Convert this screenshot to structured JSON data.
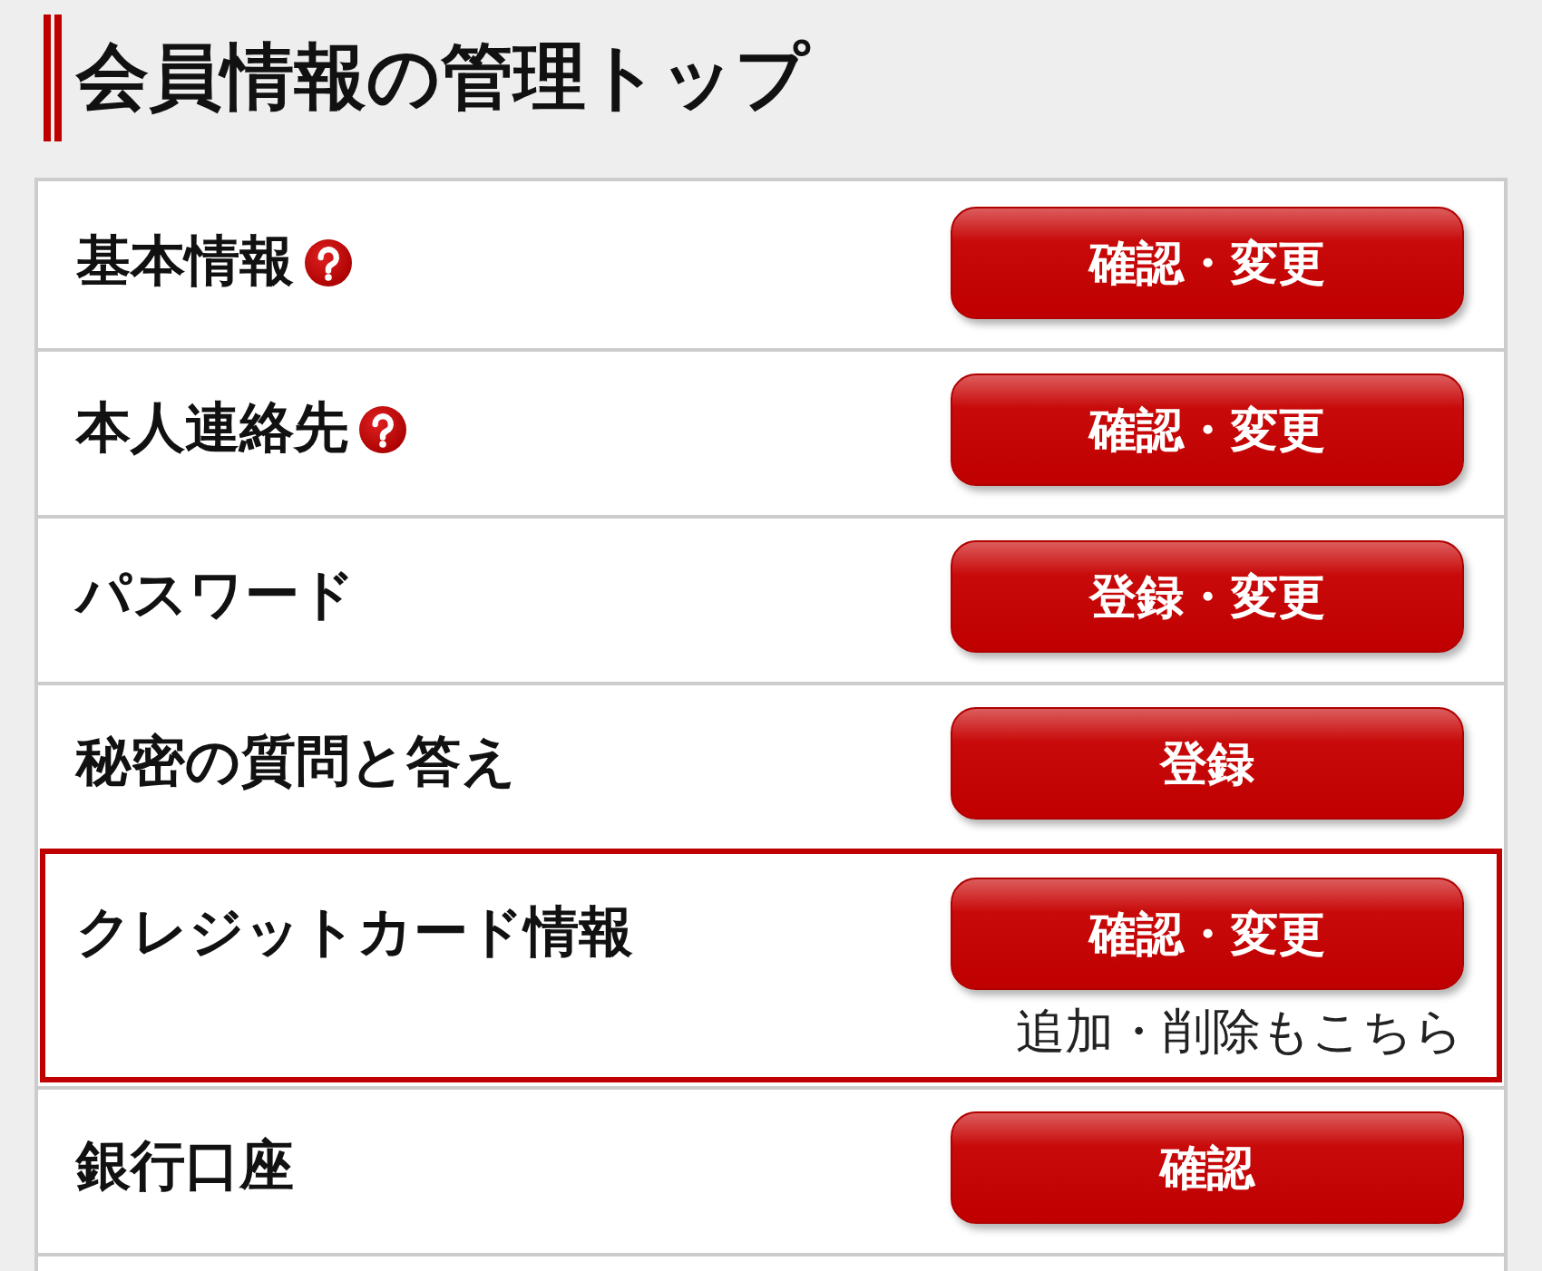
{
  "page": {
    "title": "会員情報の管理トップ"
  },
  "rows": [
    {
      "label": "基本情報",
      "help": true,
      "button": "確認・変更",
      "highlighted": false
    },
    {
      "label": "本人連絡先",
      "help": true,
      "button": "確認・変更",
      "highlighted": false
    },
    {
      "label": "パスワード",
      "help": false,
      "button": "登録・変更",
      "highlighted": false
    },
    {
      "label": "秘密の質問と答え",
      "help": false,
      "button": "登録",
      "highlighted": false
    },
    {
      "label": "クレジットカード情報",
      "help": false,
      "button": "確認・変更",
      "note": "追加・削除もこちら",
      "highlighted": true
    },
    {
      "label": "銀行口座",
      "help": false,
      "button": "確認",
      "highlighted": false
    }
  ]
}
